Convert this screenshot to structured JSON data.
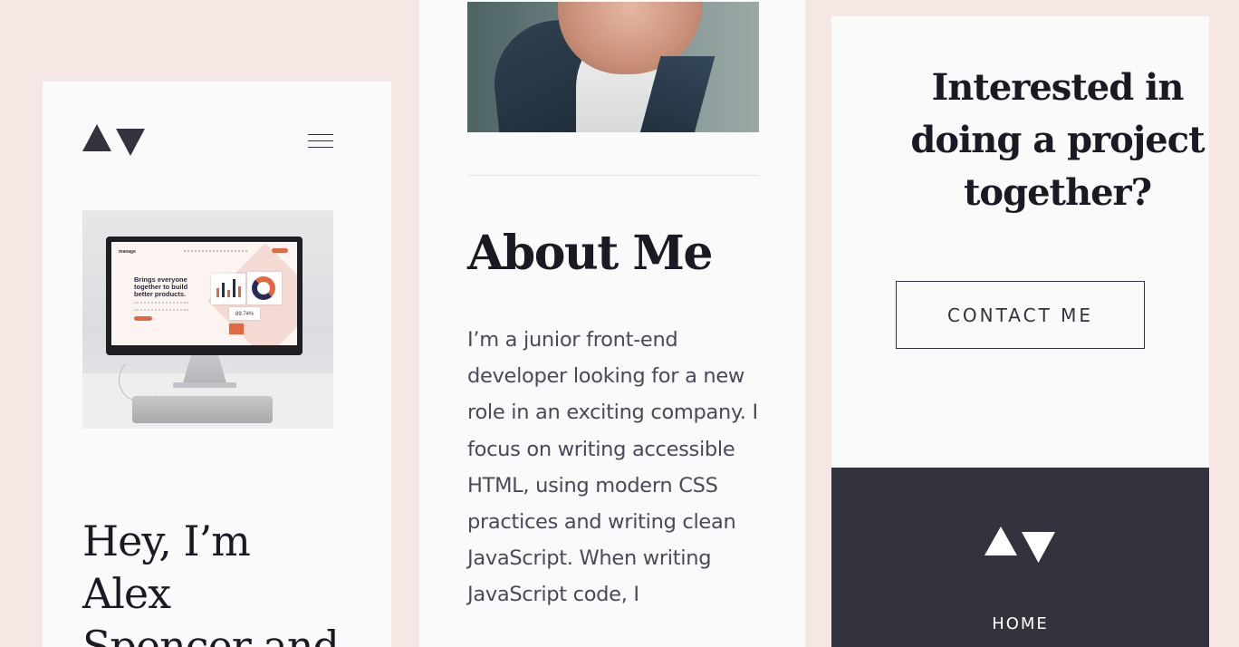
{
  "colors": {
    "background": "#f7e7e4",
    "panel": "#fafafa",
    "text_dark": "#33323d",
    "footer": "#33323d",
    "accent": "#e2693f"
  },
  "header": {
    "logo_icon": "av-logo-icon",
    "menu_icon": "hamburger-menu-icon"
  },
  "hero": {
    "mock_screen": {
      "brand": "manage",
      "headline": "Brings everyone together to build better products.",
      "stat": "89.74%"
    },
    "headline_lines": [
      "Hey, I’m",
      "Alex",
      "Spencer and"
    ]
  },
  "about": {
    "title": "About Me",
    "text": "I’m a junior front-end developer looking for a new role in an exciting company. I focus on writing accessible HTML, using modern CSS practices and writing clean JavaScript. When writing JavaScript code, I"
  },
  "cta": {
    "title": "Interested in doing a project together?",
    "button_label": "CONTACT ME"
  },
  "footer": {
    "logo_icon": "av-logo-icon",
    "nav_home": "HOME"
  }
}
